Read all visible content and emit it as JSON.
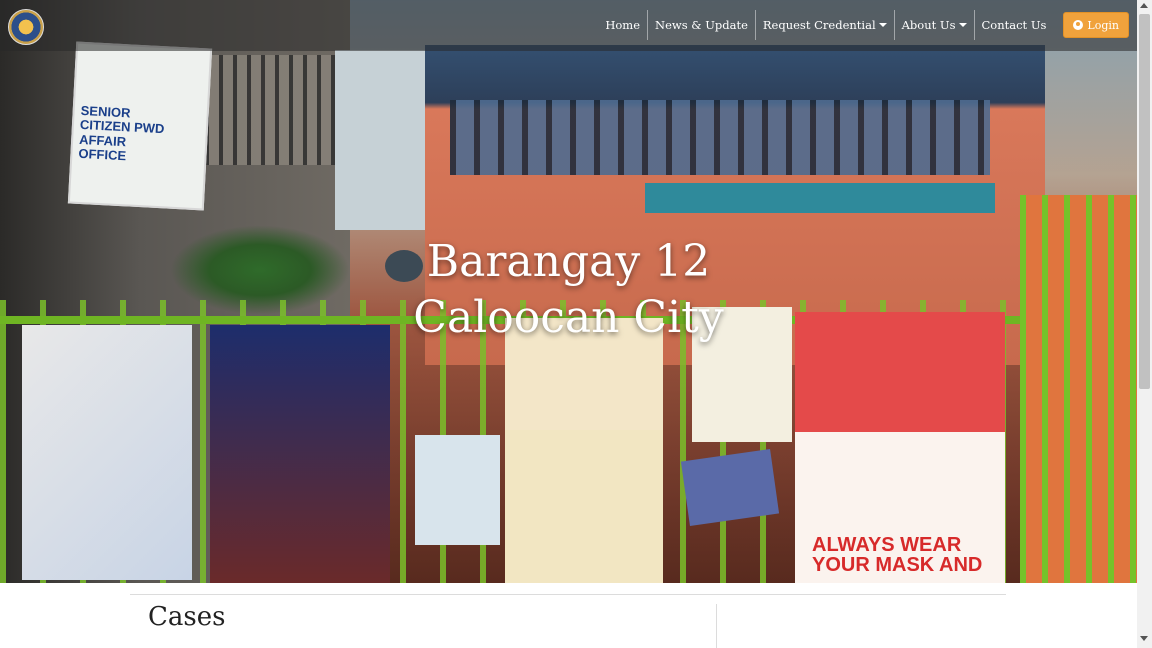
{
  "nav": {
    "items": [
      {
        "label": "Home",
        "dropdown": false
      },
      {
        "label": "News & Update",
        "dropdown": false
      },
      {
        "label": "Request Credential",
        "dropdown": true
      },
      {
        "label": "About Us",
        "dropdown": true
      },
      {
        "label": "Contact Us",
        "dropdown": false
      }
    ],
    "login_label": "Login"
  },
  "hero": {
    "title_line1": "Barangay 12",
    "title_line2": "Caloocan City"
  },
  "sign_text": "SENIOR CITIZEN PWD AFFAIR OFFICE",
  "poster_text": "ALWAYS WEAR YOUR MASK AND",
  "content": {
    "section_title": "Cases"
  },
  "colors": {
    "login_button": "#f0a23c",
    "navbar_bg": "rgba(40,40,40,0.55)"
  }
}
